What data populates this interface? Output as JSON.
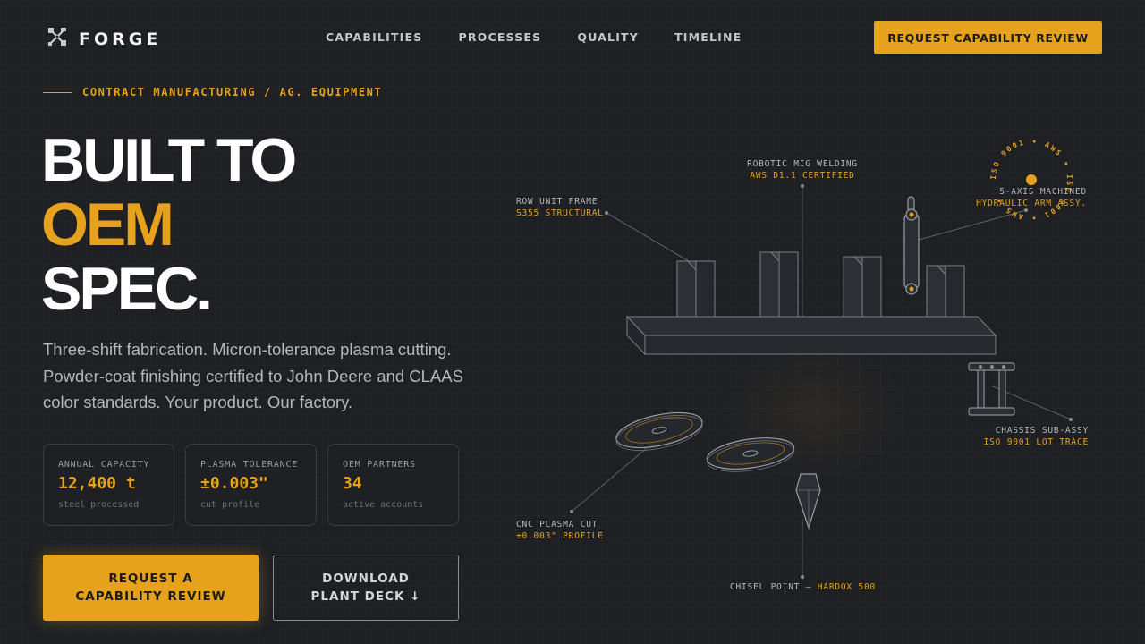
{
  "brand": {
    "name": "FORGE",
    "logo_icon": "crossed-tools-icon"
  },
  "nav": {
    "items": [
      {
        "label": "CAPABILITIES"
      },
      {
        "label": "PROCESSES"
      },
      {
        "label": "QUALITY"
      },
      {
        "label": "TIMELINE"
      }
    ],
    "cta_label": "REQUEST CAPABILITY REVIEW"
  },
  "hero": {
    "eyebrow": "CONTRACT MANUFACTURING / AG. EQUIPMENT",
    "headline": {
      "line1": "BUILT TO",
      "line2": "OEM",
      "line3": "SPEC."
    },
    "lede": "Three-shift fabrication. Micron-tolerance plasma cutting. Powder-coat finishing certified to John Deere and CLAAS color standards. Your product. Our factory.",
    "stats": [
      {
        "label": "ANNUAL CAPACITY",
        "value": "12,400 t",
        "sub": "steel processed"
      },
      {
        "label": "PLASMA TOLERANCE",
        "value": "±0.003\"",
        "sub": "cut profile"
      },
      {
        "label": "OEM PARTNERS",
        "value": "34",
        "sub": "active accounts"
      }
    ],
    "cta_primary": {
      "line1": "REQUEST A",
      "line2": "CAPABILITY REVIEW"
    },
    "cta_secondary": {
      "line1": "DOWNLOAD",
      "line2": "PLANT DECK ↓"
    }
  },
  "diagram": {
    "seal_text": "ISO 9001 • AWS • ISO 9001 • AWS •",
    "callouts": {
      "welding": {
        "title": "ROBOTIC MIG WELDING",
        "sub": "AWS D1.1 CERTIFIED"
      },
      "frame": {
        "title": "ROW UNIT FRAME",
        "sub": "S355 STRUCTURAL"
      },
      "machined": {
        "title": "5-AXIS MACHINED",
        "sub": "HYDRAULIC ARM ASSY."
      },
      "chassis": {
        "title": "CHASSIS SUB-ASSY",
        "sub": "ISO 9001 LOT TRACE"
      },
      "plasma": {
        "title": "CNC PLASMA CUT",
        "sub": "±0.003\" PROFILE"
      },
      "chisel": {
        "title": "CHISEL POINT — ",
        "sub": "HARDOX 500"
      }
    }
  },
  "colors": {
    "accent": "#e6a21d",
    "background": "#1e2024",
    "text": "#ffffff",
    "muted": "#b4b7bc"
  }
}
